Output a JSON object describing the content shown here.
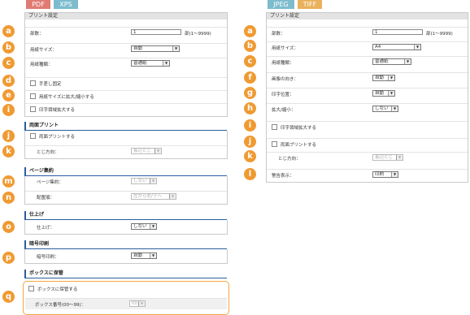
{
  "left": {
    "tabs": [
      "PDF",
      "XPS"
    ],
    "header": "プリント設定",
    "copies_label": "部数：",
    "copies_value": "1",
    "copies_unit": "部(1〜9999)",
    "paper_size_label": "用紙サイズ：",
    "paper_size_value": "自動",
    "paper_type_label": "用紙種類：",
    "paper_type_value": "普通紙",
    "manual_feed_label": "手差し固定",
    "fit_paper_label": "用紙サイズに拡大/縮小する",
    "enlarge_area_label": "印字領域拡大する",
    "duplex_section": "両面プリント",
    "duplex_label": "両面プリントする",
    "binding_label": "とじ方向：",
    "binding_value": "長辺とじ",
    "nup_section": "ページ集約",
    "nup_label": "ページ集約：",
    "nup_value": "しない",
    "order_label": "配置順：",
    "order_value": "左から右/下へ",
    "finish_section": "仕上げ",
    "finish_label": "仕上げ：",
    "finish_value": "しない",
    "secure_section": "暗号印刷",
    "secure_label": "暗号印刷：",
    "secure_value": "自動",
    "box_section": "ボックスに保管",
    "box_save_label": "ボックスに保管する",
    "box_number_label": "ボックス番号(00〜99)：",
    "box_number_value": "00"
  },
  "right": {
    "tabs": [
      "JPEG",
      "TIFF"
    ],
    "header": "プリント設定",
    "copies_label": "部数：",
    "copies_value": "1",
    "copies_unit": "部(1〜9999)",
    "paper_size_label": "用紙サイズ：",
    "paper_size_value": "A4",
    "paper_type_label": "用紙種類：",
    "paper_type_value": "普通紙",
    "orientation_label": "画像の向き：",
    "orientation_value": "自動",
    "position_label": "印字位置：",
    "position_value": "自動",
    "scale_label": "拡大/縮小：",
    "scale_value": "しない",
    "enlarge_area_label": "印字領域拡大する",
    "duplex_label": "両面プリントする",
    "binding_label": "とじ方向：",
    "binding_value": "長辺とじ",
    "warning_label": "警告表示：",
    "warning_value": "印刷"
  },
  "badges": {
    "a": "a",
    "b": "b",
    "c": "c",
    "d": "d",
    "e": "e",
    "i": "i",
    "j": "j",
    "k": "k",
    "m": "m",
    "n": "n",
    "o": "o",
    "p": "p",
    "q": "q",
    "f": "f",
    "g": "g",
    "h": "h",
    "l": "l"
  },
  "colors": {
    "badge": "#f09a32",
    "section_accent": "#2a5d9f",
    "pdf_tag": "#e07b74",
    "xps_tag": "#7cbccd",
    "tiff_tag": "#e9b15c"
  }
}
